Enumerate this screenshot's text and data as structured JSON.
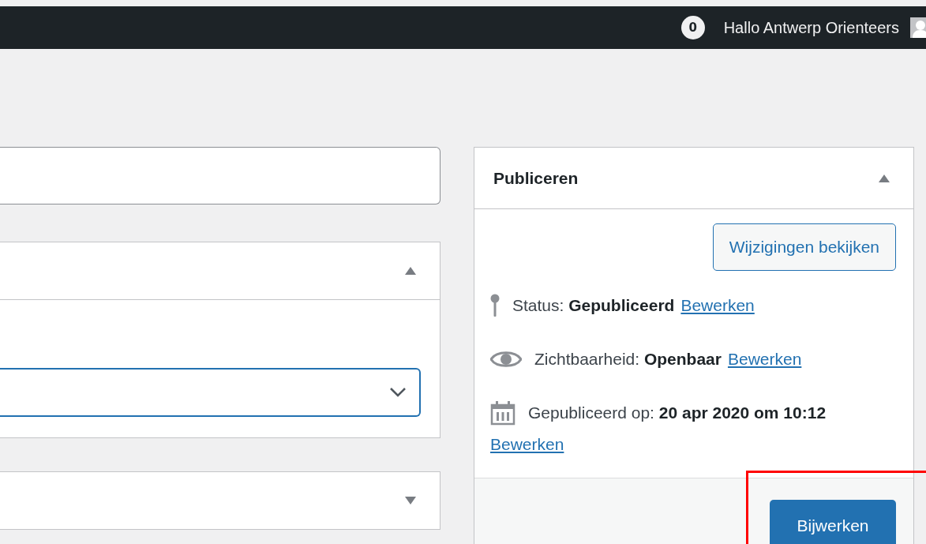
{
  "admin_bar": {
    "comments_count": "0",
    "greeting": "Hallo Antwerp Orienteers"
  },
  "boxes": [
    {
      "expanded": true
    },
    {
      "expanded": false
    }
  ],
  "publish_box": {
    "title": "Publiceren",
    "expanded": true,
    "preview_button": "Wijzigingen bekijken",
    "rows": [
      {
        "kind": "status",
        "text": "Status: **Gepubliceerd**",
        "link": "Bewerken"
      },
      {
        "kind": "visibility",
        "text": "Zichtbaarheid: **Openbaar**",
        "link": "Bewerken"
      },
      {
        "kind": "date",
        "text": "Gepubliceerd op: **20 apr 2020 om 10:12**",
        "link": "Bewerken"
      }
    ],
    "update_button": "Bijwerken"
  }
}
